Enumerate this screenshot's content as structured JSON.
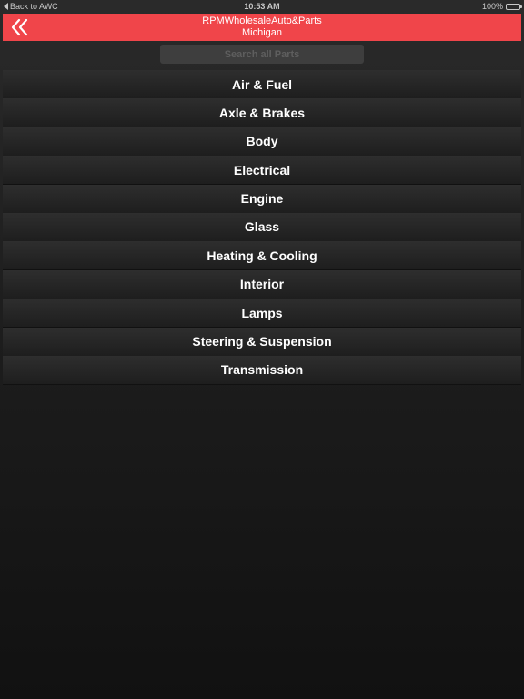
{
  "status_bar": {
    "back_label": "Back to AWC",
    "time": "10:53 AM",
    "battery": "100%"
  },
  "header": {
    "title_line1": "RPMWholesaleAuto&Parts",
    "title_line2": "Michigan",
    "back_icon": "double-chevron-left-icon",
    "background_color": "#f0454a"
  },
  "search": {
    "placeholder": "Search all Parts",
    "value": ""
  },
  "categories": [
    {
      "label": "Air & Fuel"
    },
    {
      "label": "Axle & Brakes"
    },
    {
      "label": "Body"
    },
    {
      "label": "Electrical"
    },
    {
      "label": "Engine"
    },
    {
      "label": "Glass"
    },
    {
      "label": "Heating & Cooling"
    },
    {
      "label": "Interior"
    },
    {
      "label": "Lamps"
    },
    {
      "label": "Steering & Suspension"
    },
    {
      "label": "Transmission"
    }
  ]
}
